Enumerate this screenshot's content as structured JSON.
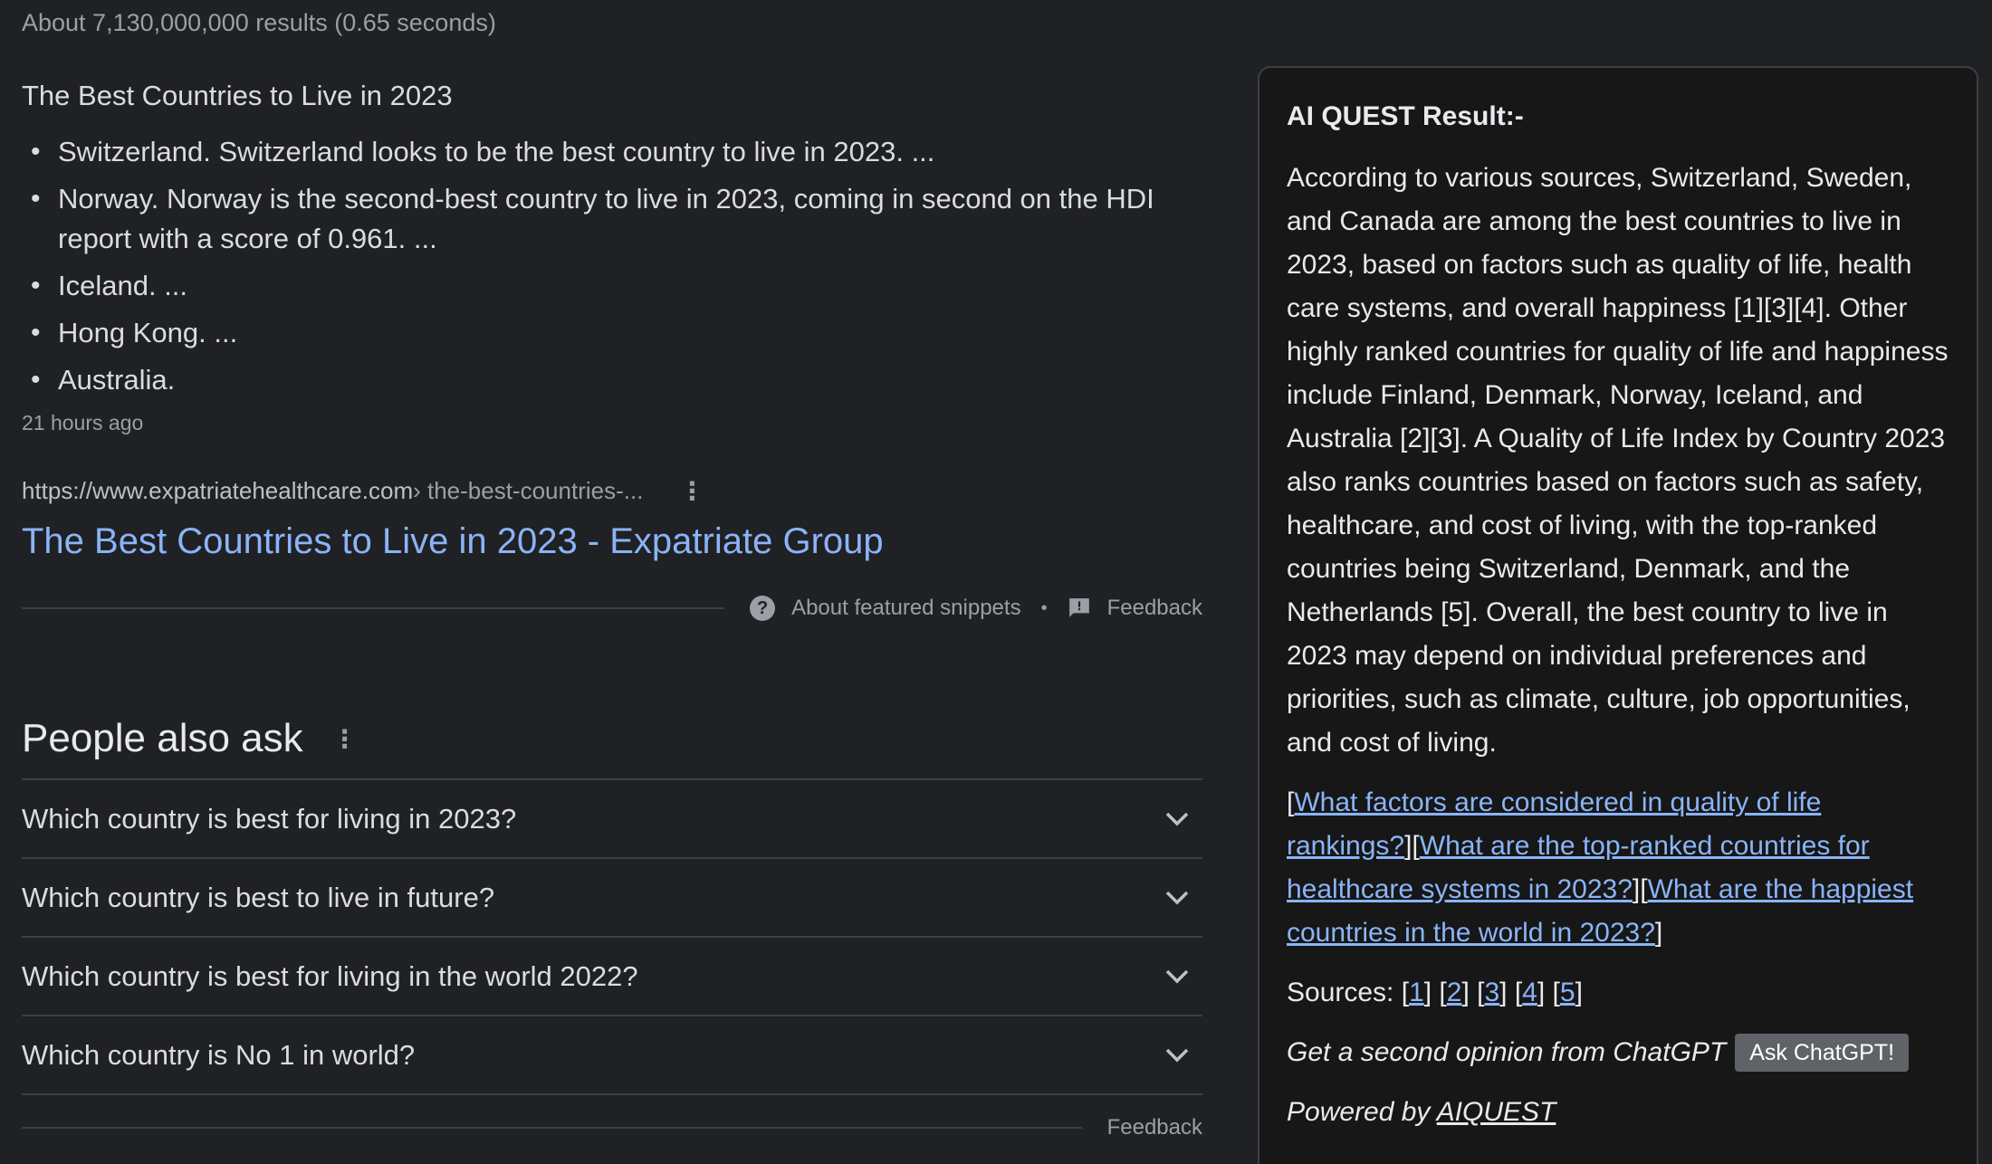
{
  "result_stats": "About 7,130,000,000 results (0.65 seconds)",
  "featured_snippet": {
    "title": "The Best Countries to Live in 2023",
    "items": [
      "Switzerland. Switzerland looks to be the best country to live in 2023. ...",
      "Norway. Norway is the second-best country to live in 2023, coming in second on the HDI report with a score of 0.961. ...",
      "Iceland. ...",
      "Hong Kong. ...",
      "Australia."
    ],
    "timestamp": "21 hours ago",
    "url_domain": "https://www.expatriatehealthcare.com",
    "url_path": " › the-best-countries-...",
    "result_title": "The Best Countries to Live in 2023 - Expatriate Group",
    "about_label": "About featured snippets",
    "feedback_label": "Feedback"
  },
  "people_also_ask": {
    "title": "People also ask",
    "questions": [
      "Which country is best for living in 2023?",
      "Which country is best to live in future?",
      "Which country is best for living in the world 2022?",
      "Which country is No 1 in world?"
    ],
    "feedback_label": "Feedback"
  },
  "ai_panel": {
    "heading": "AI QUEST Result:-",
    "body": "According to various sources, Switzerland, Sweden, and Canada are among the best countries to live in 2023, based on factors such as quality of life, health care systems, and overall happiness [1][3][4]. Other highly ranked countries for quality of life and happiness include Finland, Denmark, Norway, Iceland, and Australia [2][3]. A Quality of Life Index by Country 2023 also ranks countries based on factors such as safety, healthcare, and cost of living, with the top-ranked countries being Switzerland, Denmark, and the Netherlands [5]. Overall, the best country to live in 2023 may depend on individual preferences and priorities, such as climate, culture, job opportunities, and cost of living.",
    "related_questions": [
      "What factors are considered in quality of life rankings?",
      "What are the top-ranked countries for healthcare systems in 2023?",
      "What are the happiest countries in the world in 2023?"
    ],
    "sources_label": "Sources:",
    "sources": [
      "1",
      "2",
      "3",
      "4",
      "5"
    ],
    "second_opinion_label": "Get a second opinion from ChatGPT",
    "ask_button_label": "Ask ChatGPT!",
    "powered_by_label": "Powered by",
    "powered_by_link": "AIQUEST"
  },
  "colors": {
    "background": "#202124",
    "panel_background": "#171717",
    "link": "#8ab4f8"
  }
}
